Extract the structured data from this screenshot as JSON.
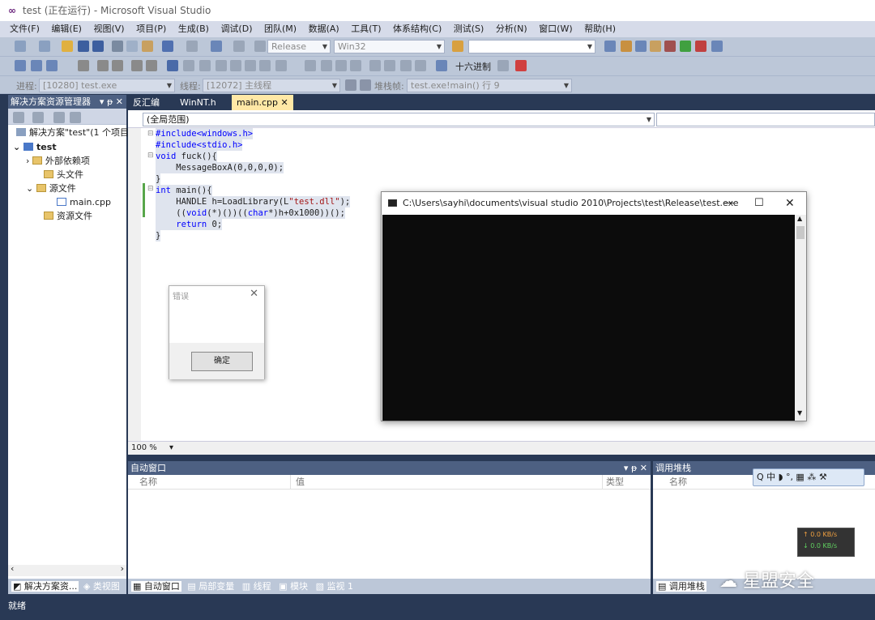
{
  "window": {
    "title": "test (正在运行) - Microsoft Visual Studio"
  },
  "menu": [
    "文件(F)",
    "编辑(E)",
    "视图(V)",
    "项目(P)",
    "生成(B)",
    "调试(D)",
    "团队(M)",
    "数据(A)",
    "工具(T)",
    "体系结构(C)",
    "测试(S)",
    "分析(N)",
    "窗口(W)",
    "帮助(H)"
  ],
  "toolbar": {
    "config": "Release",
    "platform": "Win32",
    "hex_label": "十六进制",
    "process_label": "进程:",
    "process_value": "[10280] test.exe",
    "thread_label": "线程:",
    "thread_value": "[12072] 主线程",
    "stack_label": "堆栈帧:",
    "stack_value": "test.exe!main()  行 9"
  },
  "solution_explorer": {
    "title": "解决方案资源管理器",
    "title_controls": "▾ ᵽ ✕",
    "solution": "解决方案\"test\"(1 个项目)",
    "project": "test",
    "items": [
      "外部依赖项",
      "头文件",
      "源文件",
      "main.cpp",
      "资源文件"
    ]
  },
  "sol_tabs": {
    "solution": "解决方案资...",
    "class_view": "类视图"
  },
  "doc_tabs": [
    "反汇编",
    "WinNT.h",
    "main.cpp"
  ],
  "scope": "(全局范围)",
  "code_lines": [
    [
      "#include<windows.h>"
    ],
    [
      "#include<stdio.h>"
    ],
    [
      "void",
      " fuck(){"
    ],
    [
      "    MessageBoxA(0,0,0,0);"
    ],
    [
      "}"
    ],
    [
      "int",
      " main(){"
    ],
    [
      "    HANDLE h=LoadLibrary(L",
      "\"test.dll\"",
      ");"
    ],
    [
      "    ((",
      "void",
      "(*)())((",
      "char",
      "*)h+0x1000))();"
    ],
    [
      "    ",
      "return",
      " 0;"
    ],
    [
      "}"
    ]
  ],
  "zoom": "100 %",
  "dialog": {
    "title": "错误",
    "ok": "确定"
  },
  "console": {
    "title": "C:\\Users\\sayhi\\documents\\visual studio 2010\\Projects\\test\\Release\\test.exe"
  },
  "autos": {
    "title": "自动窗口",
    "col_name": "名称",
    "col_value": "值",
    "col_type": "类型",
    "controls": "▾ ᵽ ✕"
  },
  "callstack": {
    "title": "调用堆栈",
    "col_name": "名称"
  },
  "bottom_tabs": [
    "自动窗口",
    "局部变量",
    "线程",
    "模块",
    "监视 1"
  ],
  "call_tab": "调用堆栈",
  "status": "就绪",
  "ime": "Q 中 ◗ °, ▦ ⁂ ⚒",
  "net": {
    "up": "↑ 0.0 KB/s",
    "down": "↓ 0.0 KB/s"
  },
  "watermark": "星盟安全"
}
